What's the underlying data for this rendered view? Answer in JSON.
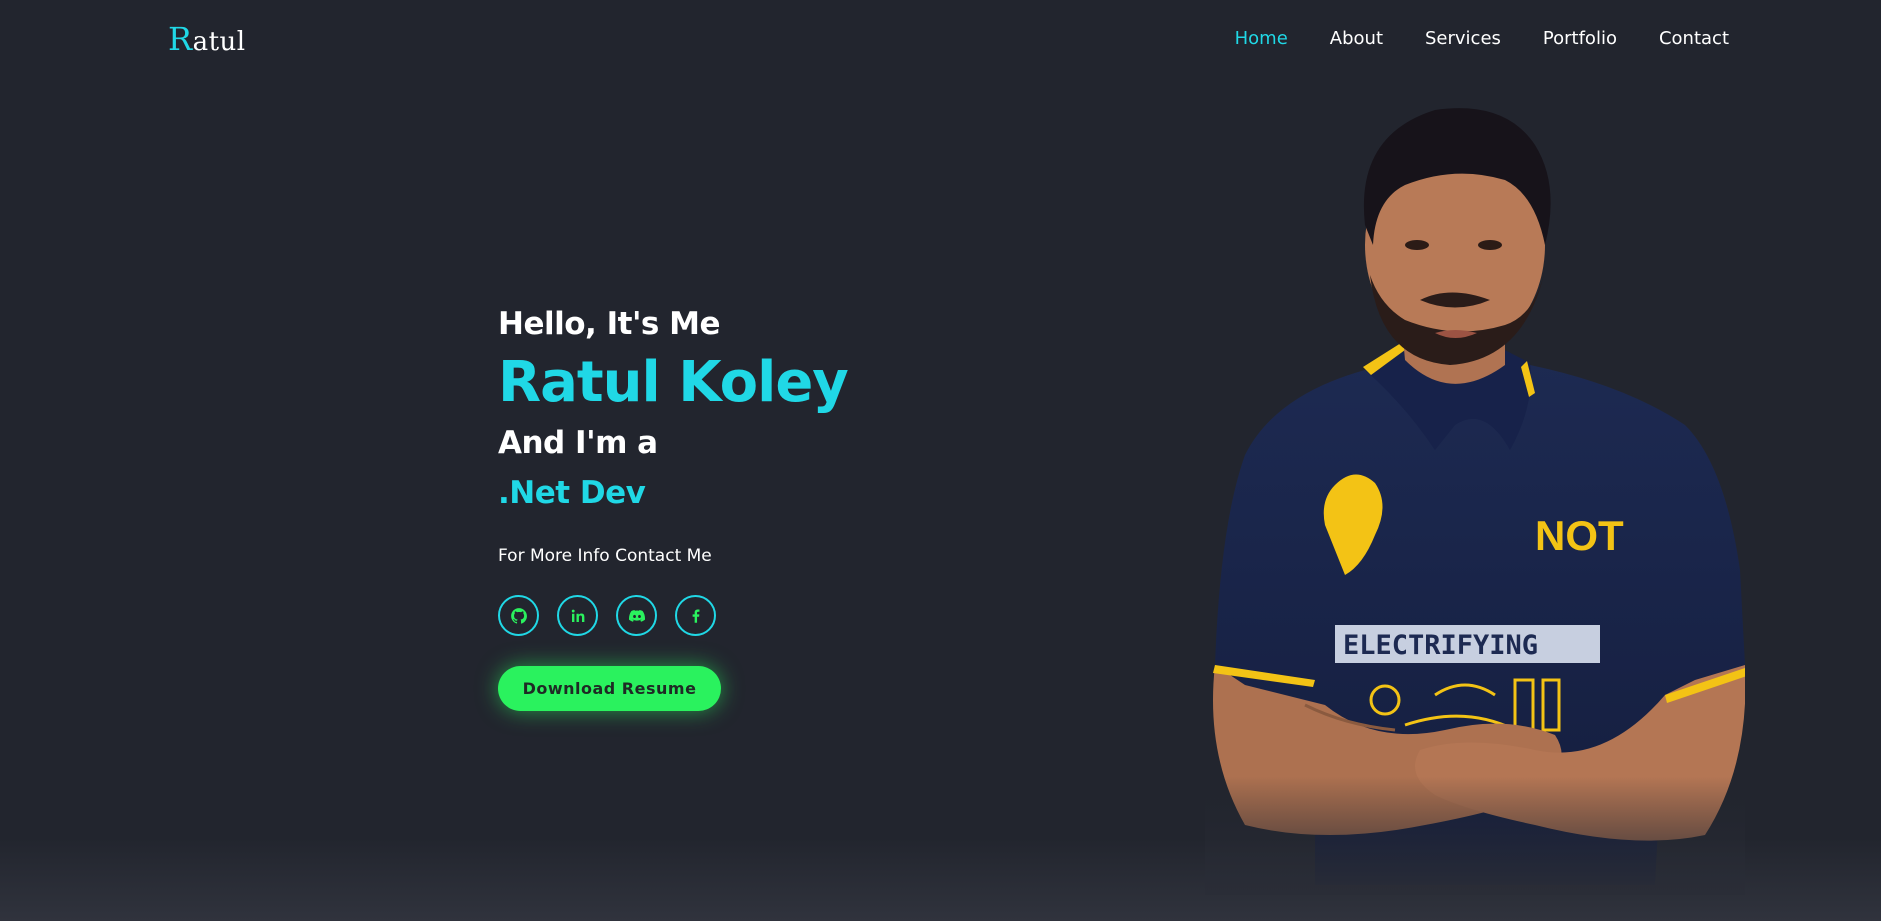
{
  "header": {
    "logo_first": "R",
    "logo_rest": "atul",
    "nav": [
      "Home",
      "About",
      "Services",
      "Portfolio",
      "Contact"
    ],
    "active_nav": "Home"
  },
  "hero": {
    "greeting": "Hello, It's Me",
    "name": "Ratul Koley",
    "intro": "And I'm a",
    "role": ".Net Dev",
    "info": "For More Info Contact Me",
    "socials": [
      "github-icon",
      "linkedin-icon",
      "discord-icon",
      "facebook-icon"
    ],
    "resume_button": "Download Resume"
  },
  "colors": {
    "background": "#22252e",
    "accent": "#20d8e6",
    "button": "#2af25e",
    "text": "#ffffff"
  }
}
